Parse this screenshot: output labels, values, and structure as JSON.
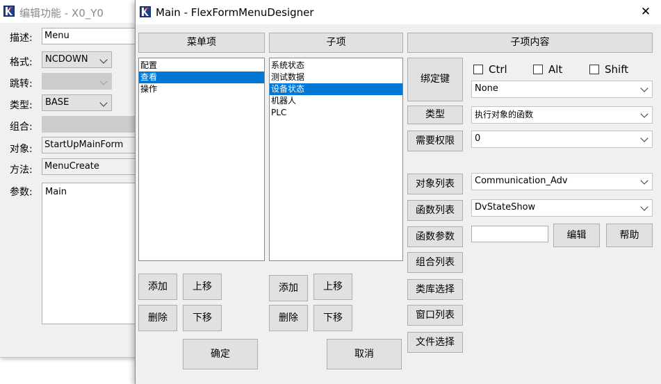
{
  "back_window": {
    "title": "编辑功能 - X0_Y0",
    "labels": {
      "desc": "描述:",
      "format": "格式:",
      "jump": "跳转:",
      "type": "类型:",
      "group": "组合:",
      "object": "对象:",
      "method": "方法:",
      "params": "参数:"
    },
    "values": {
      "desc": "Menu",
      "format": "NCDOWN",
      "type": "BASE",
      "object": "StartUpMainForm",
      "method": "MenuCreate",
      "params": "Main"
    }
  },
  "main_window": {
    "title": "Main - FlexFormMenuDesigner",
    "close_glyph": "✕",
    "headers": {
      "menu": "菜单项",
      "sub": "子项",
      "content": "子项内容"
    },
    "menu_items": [
      {
        "label": "配置",
        "selected": false
      },
      {
        "label": "查看",
        "selected": true
      },
      {
        "label": "操作",
        "selected": false
      }
    ],
    "sub_items": [
      {
        "label": "系统状态",
        "selected": false
      },
      {
        "label": "测试数据",
        "selected": false
      },
      {
        "label": "设备状态",
        "selected": true
      },
      {
        "label": "机器人",
        "selected": false
      },
      {
        "label": "PLC",
        "selected": false
      }
    ],
    "menu_buttons": {
      "add": "添加",
      "up": "上移",
      "delete": "删除",
      "down": "下移"
    },
    "sub_buttons": {
      "add": "添加",
      "up": "上移",
      "delete": "删除",
      "down": "下移"
    },
    "ok": "确定",
    "cancel": "取消",
    "content": {
      "bind_key": "绑定键",
      "ctrl": "Ctrl",
      "alt": "Alt",
      "shift": "Shift",
      "key_value": "None",
      "type_btn": "类型",
      "type_value": "执行对象的函数",
      "perm_btn": "需要权限",
      "perm_value": "0",
      "obj_list_btn": "对象列表",
      "obj_value": "Communication_Adv",
      "func_list_btn": "函数列表",
      "func_value": "DvStateShow",
      "func_param_btn": "函数参数",
      "edit_btn": "编辑",
      "help_btn": "帮助",
      "group_list_btn": "组合列表",
      "lib_select_btn": "类库选择",
      "window_list_btn": "窗口列表",
      "file_select_btn": "文件选择"
    }
  },
  "colors": {
    "selection": "#0078d7",
    "window_bg": "#f0f0f0",
    "button_bg": "#e1e1e1",
    "app_icon": "#1f3f8f"
  }
}
